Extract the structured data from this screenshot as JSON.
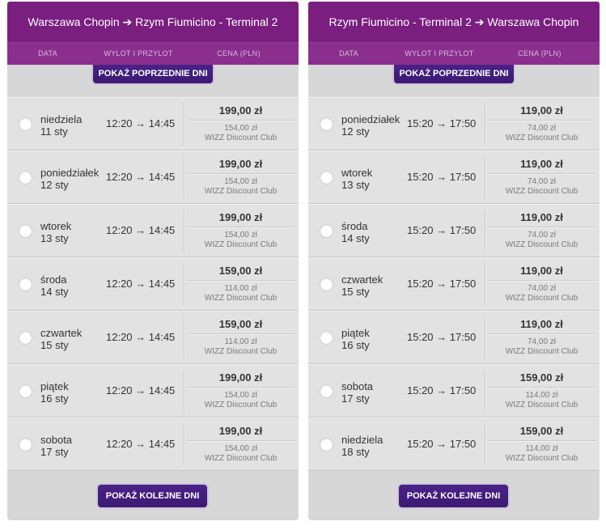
{
  "colors": {
    "header_bg": "#7a1e80",
    "subheader_bg": "#8a2f8e",
    "button_bg": "#421f7d",
    "panel_bg": "#d7d7d7",
    "row_bg": "#e2e2e2"
  },
  "panels": [
    {
      "title": "Warszawa Chopin ➔ Rzym Fiumicino - Terminal 2",
      "columns": {
        "date": "DATA",
        "times": "WYLOT I PRZYLOT",
        "price": "CENA (PLN)"
      },
      "prev_button": "POKAŻ POPRZEDNIE DNI",
      "next_button": "POKAŻ KOLEJNE DNI",
      "rows": [
        {
          "day": "niedziela",
          "date": "11 sty",
          "times": "12:20 → 14:45",
          "price": "199,00 zł",
          "club_price": "154,00 zł",
          "club_label": "WIZZ Discount Club"
        },
        {
          "day": "poniedziałek",
          "date": "12 sty",
          "times": "12:20 → 14:45",
          "price": "199,00 zł",
          "club_price": "154,00 zł",
          "club_label": "WIZZ Discount Club"
        },
        {
          "day": "wtorek",
          "date": "13 sty",
          "times": "12:20 → 14:45",
          "price": "199,00 zł",
          "club_price": "154,00 zł",
          "club_label": "WIZZ Discount Club"
        },
        {
          "day": "środa",
          "date": "14 sty",
          "times": "12:20 → 14:45",
          "price": "159,00 zł",
          "club_price": "114,00 zł",
          "club_label": "WIZZ Discount Club"
        },
        {
          "day": "czwartek",
          "date": "15 sty",
          "times": "12:20 → 14:45",
          "price": "159,00 zł",
          "club_price": "114,00 zł",
          "club_label": "WIZZ Discount Club"
        },
        {
          "day": "piątek",
          "date": "16 sty",
          "times": "12:20 → 14:45",
          "price": "199,00 zł",
          "club_price": "154,00 zł",
          "club_label": "WIZZ Discount Club"
        },
        {
          "day": "sobota",
          "date": "17 sty",
          "times": "12:20 → 14:45",
          "price": "199,00 zł",
          "club_price": "154,00 zł",
          "club_label": "WIZZ Discount Club"
        }
      ]
    },
    {
      "title": "Rzym Fiumicino - Terminal 2 ➔ Warszawa Chopin",
      "columns": {
        "date": "DATA",
        "times": "WYLOT I PRZYLOT",
        "price": "CENA (PLN)"
      },
      "prev_button": "POKAŻ POPRZEDNIE DNI",
      "next_button": "POKAŻ KOLEJNE DNI",
      "rows": [
        {
          "day": "poniedziałek",
          "date": "12 sty",
          "times": "15:20 → 17:50",
          "price": "119,00 zł",
          "club_price": "74,00 zł",
          "club_label": "WIZZ Discount Club"
        },
        {
          "day": "wtorek",
          "date": "13 sty",
          "times": "15:20 → 17:50",
          "price": "119,00 zł",
          "club_price": "74,00 zł",
          "club_label": "WIZZ Discount Club"
        },
        {
          "day": "środa",
          "date": "14 sty",
          "times": "15:20 → 17:50",
          "price": "119,00 zł",
          "club_price": "74,00 zł",
          "club_label": "WIZZ Discount Club"
        },
        {
          "day": "czwartek",
          "date": "15 sty",
          "times": "15:20 → 17:50",
          "price": "119,00 zł",
          "club_price": "74,00 zł",
          "club_label": "WIZZ Discount Club"
        },
        {
          "day": "piątek",
          "date": "16 sty",
          "times": "15:20 → 17:50",
          "price": "119,00 zł",
          "club_price": "74,00 zł",
          "club_label": "WIZZ Discount Club"
        },
        {
          "day": "sobota",
          "date": "17 sty",
          "times": "15:20 → 17:50",
          "price": "159,00 zł",
          "club_price": "114,00 zł",
          "club_label": "WIZZ Discount Club"
        },
        {
          "day": "niedziela",
          "date": "18 sty",
          "times": "15:20 → 17:50",
          "price": "159,00 zł",
          "club_price": "114,00 zł",
          "club_label": "WIZZ Discount Club"
        }
      ]
    }
  ]
}
